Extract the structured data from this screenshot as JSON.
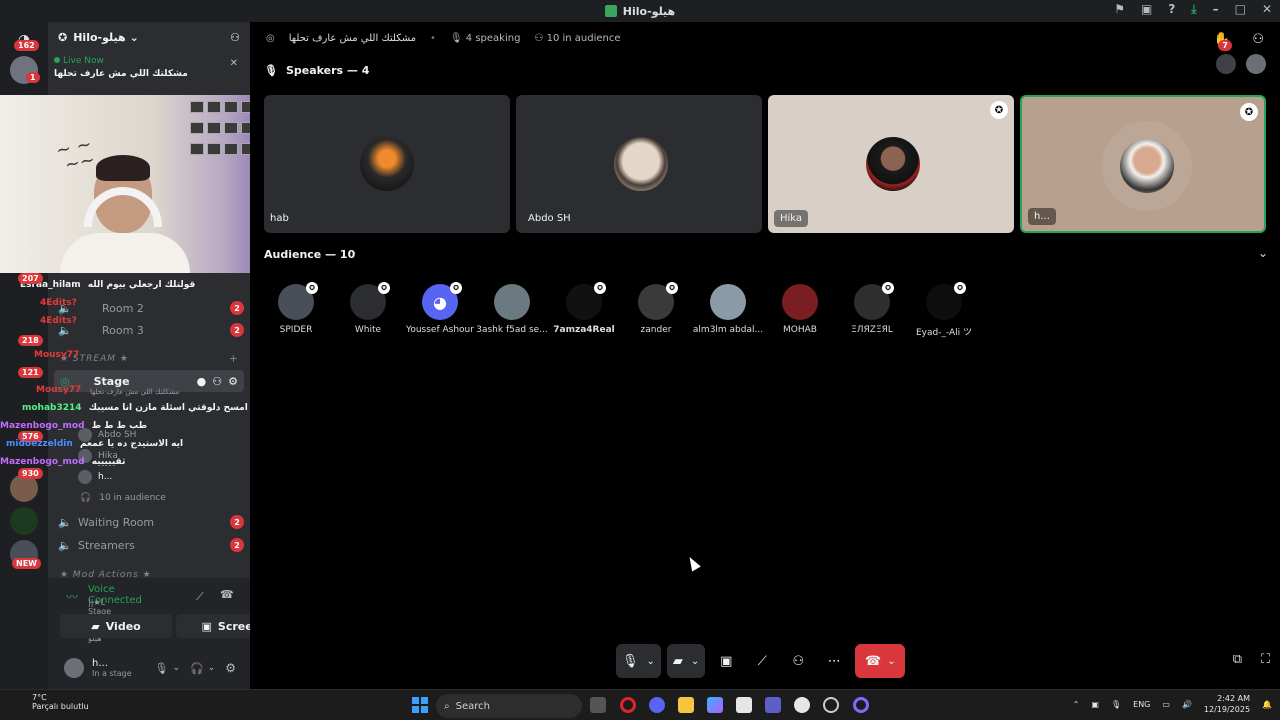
{
  "window": {
    "title": "Hilo-هيلو"
  },
  "rail": {
    "badge_top": "162",
    "badge_2": "1",
    "badge_new": "NEW"
  },
  "server": {
    "name": "Hilo-هيلو"
  },
  "live": {
    "label": "Live Now",
    "topic": "مشكلتك اللي مش عارف تحلها"
  },
  "channels": [
    {
      "name": "Room 2",
      "badge": "2"
    },
    {
      "name": "Room 3",
      "badge": "2"
    },
    {
      "name": "Stage"
    },
    {
      "name": "Waiting Room",
      "badge": "2"
    },
    {
      "name": "Streamers",
      "badge": "2"
    }
  ],
  "category_stream": "★ STREAM ★",
  "category_mod": "★ Mod Actions ★",
  "stage_sub": "مشكلتك اللي مش عارف تحلها",
  "stage_members": [
    "Abdo SH",
    "Hika",
    "h..."
  ],
  "stage_audience": "10 in audience",
  "chat_overlay": [
    {
      "user": "Esraa_hilam",
      "msg": "قولتلك ارجعلي بيوم الله",
      "color": "#f2f3f5",
      "count": "207"
    },
    {
      "user": "4Edits?",
      "msg": "",
      "color": "#e23b3b",
      "count": ""
    },
    {
      "user": "4Edits?",
      "msg": "",
      "color": "#e23b3b",
      "count": "218"
    },
    {
      "user": "Mousy77",
      "msg": "",
      "color": "#e23b3b",
      "count": "121"
    },
    {
      "user": "Mousy77",
      "msg": "",
      "color": "#e23b3b",
      "count": ""
    },
    {
      "user": "mohab3214",
      "msg": "امسح دلوقتي اسئلة مازن انا مسيبك",
      "color": "#57f287",
      "count": ""
    },
    {
      "user": "Mazenbogo_mod",
      "msg": "طب ط ط ط",
      "color": "#c26bff",
      "count": ""
    },
    {
      "user": "midoezzeldin",
      "msg": "ايه الاستيدج ده يا عمعم",
      "color": "#4f8cff",
      "count": "576"
    },
    {
      "user": "Mazenbogo_mod",
      "msg": "ثقيييييه",
      "color": "#c26bff",
      "count": "930"
    }
  ],
  "voice": {
    "status": "Voice Connected",
    "location": "||★L Stage | / Hilo-هيلو",
    "video_label": "Video",
    "screen_label": "Screen"
  },
  "user": {
    "name": "h...",
    "status": "In a stage"
  },
  "topbar": {
    "topic": "مشكلتك اللي مش عارف تحلها",
    "speaking": "4 speaking",
    "audience": "10 in audience",
    "raise_count": "7"
  },
  "speakers_title": "Speakers — 4",
  "speakers": [
    {
      "name": "hab"
    },
    {
      "name": "Abdo SH"
    },
    {
      "name": "Hika"
    },
    {
      "name": "h..."
    }
  ],
  "audience_title": "Audience — 10",
  "audience": [
    {
      "name": "SPIDER"
    },
    {
      "name": "White"
    },
    {
      "name": "Youssef Ashour"
    },
    {
      "name": "3ashk f5ad se..."
    },
    {
      "name": "7amza4Real"
    },
    {
      "name": "zander"
    },
    {
      "name": "alm3lm abdal..."
    },
    {
      "name": "MOHAB"
    },
    {
      "name": "ΞЛЯZΞЯL"
    },
    {
      "name": "Eyad-_-Ali ツ"
    }
  ],
  "taskbar": {
    "weather_temp": "7°C",
    "weather_desc": "Parçalı bulutlu",
    "search": "Search",
    "lang": "ENG",
    "time": "2:42 AM",
    "date": "12/19/2025"
  }
}
